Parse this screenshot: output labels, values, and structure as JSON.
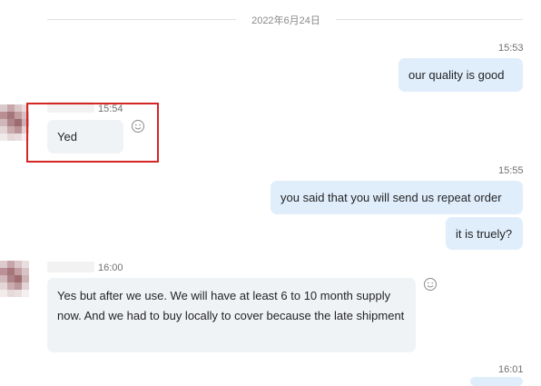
{
  "date_divider": "2022年6月24日",
  "messages": [
    {
      "time": "15:53",
      "text": "our quality is good"
    },
    {
      "time": "15:54",
      "text": "Yed"
    },
    {
      "time": "15:55",
      "text": "you said that you will send us repeat order"
    },
    {
      "text": "it is truely?"
    },
    {
      "time": "16:00",
      "text": "Yes but after we use.  We will have at least 6 to 10 month supply now.  And we had to buy locally to cover because the late shipment"
    },
    {
      "time": "16:01"
    }
  ],
  "icons": {
    "reaction": "smiley-reaction-icon",
    "avatar": "pixelated-avatar"
  },
  "colors": {
    "outgoing_bubble": "#e0eefc",
    "incoming_bubble": "#f0f3f6",
    "highlight": "#d62525"
  }
}
